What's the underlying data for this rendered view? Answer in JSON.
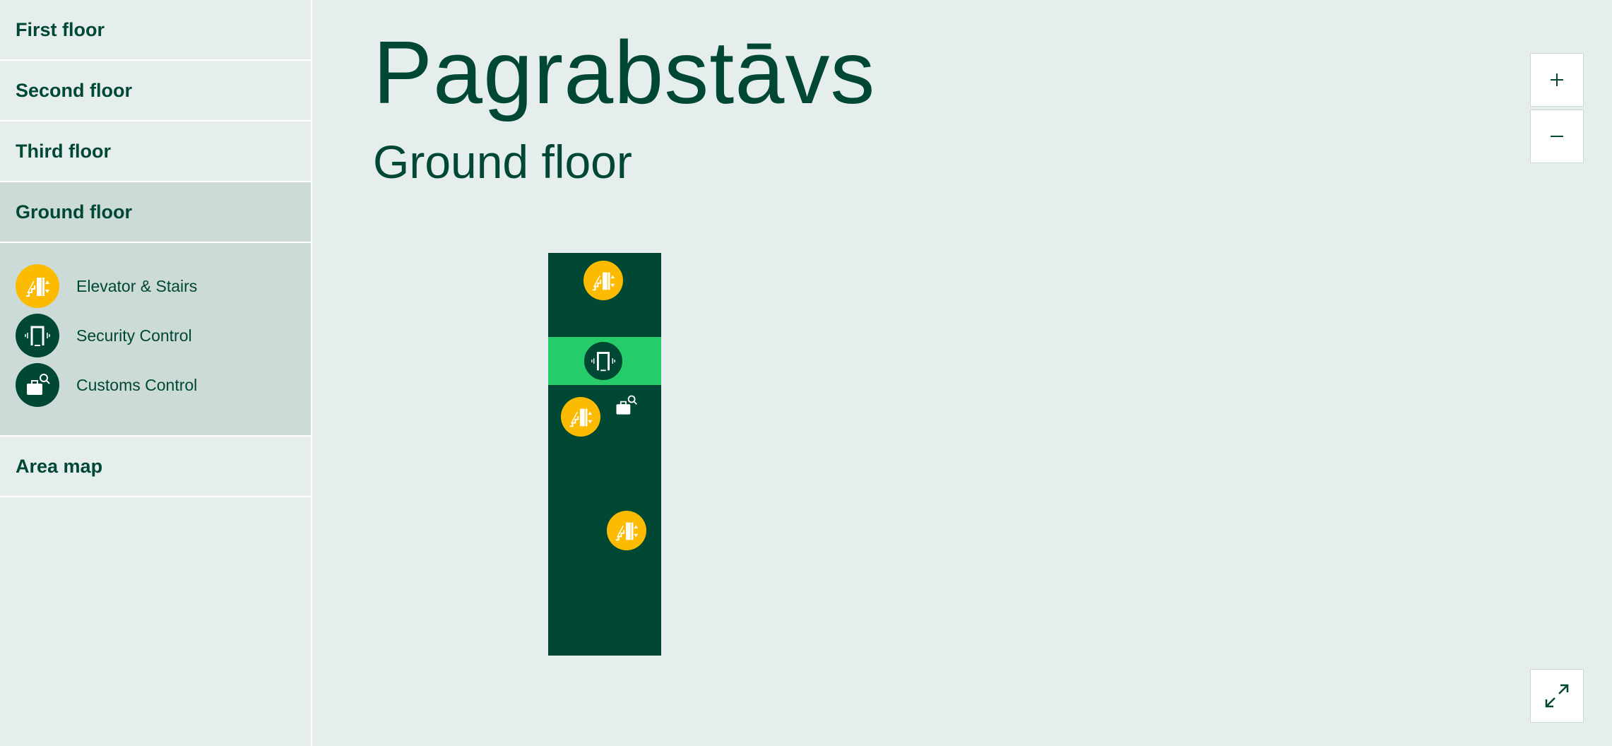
{
  "sidebar": {
    "floors": [
      {
        "label": "First floor"
      },
      {
        "label": "Second floor"
      },
      {
        "label": "Third floor"
      },
      {
        "label": "Ground floor",
        "active": true
      }
    ],
    "legend": [
      {
        "icon": "elevator-stairs-icon",
        "label": "Elevator & Stairs"
      },
      {
        "icon": "security-gate-icon",
        "label": "Security Control"
      },
      {
        "icon": "customs-bag-icon",
        "label": "Customs Control"
      }
    ],
    "area_map": "Area map"
  },
  "header": {
    "title": "Pagrabstāvs",
    "subtitle": "Ground floor"
  },
  "controls": {
    "zoom_in": "+",
    "zoom_out": "−"
  },
  "colors": {
    "brand_dark": "#004833",
    "accent_yellow": "#fcba00",
    "accent_green": "#27cc6a",
    "background": "#e5eeec",
    "active_panel": "#ccdbd7"
  }
}
